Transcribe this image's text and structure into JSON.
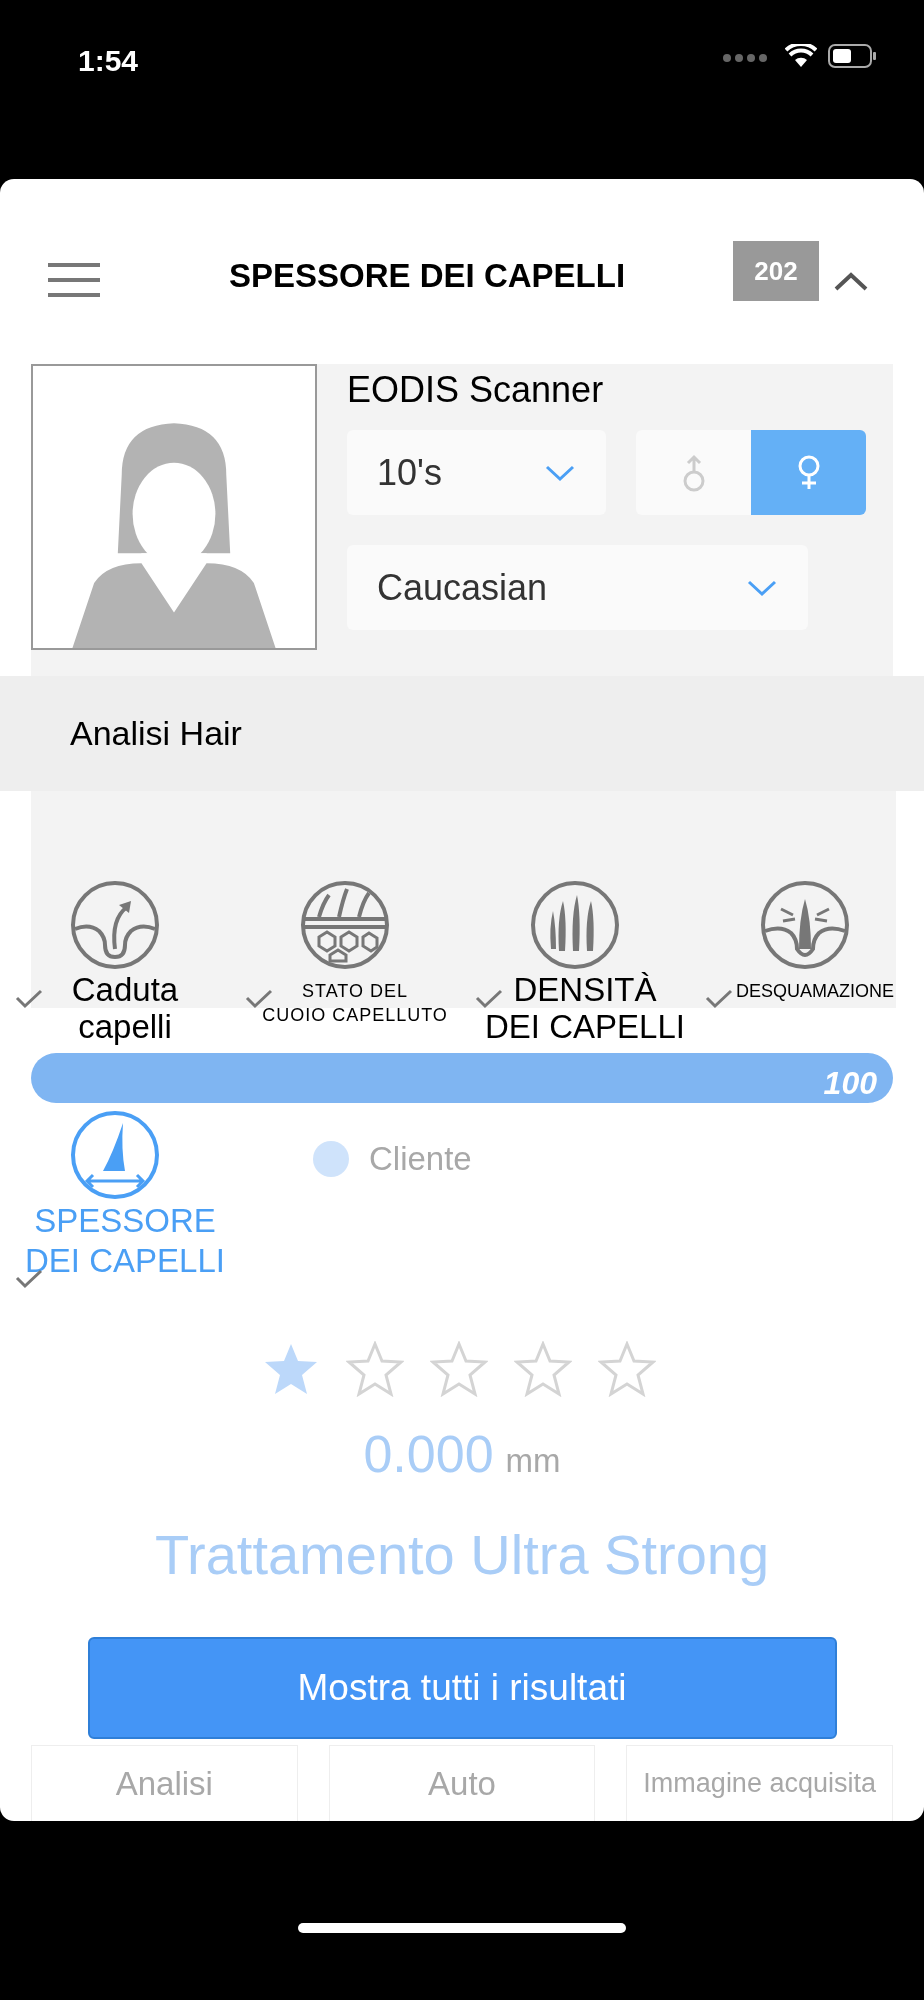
{
  "status_bar": {
    "time": "1:54"
  },
  "header": {
    "title": "SPESSORE DEI CAPELLI",
    "badge": "202"
  },
  "profile": {
    "device_name": "EODIS Scanner",
    "age": "10's",
    "gender": [
      {
        "kind": "male",
        "selected": false
      },
      {
        "kind": "female",
        "selected": true
      }
    ],
    "ethnicity": "Caucasian"
  },
  "section_title": "Analisi Hair",
  "categories": [
    {
      "kind": "hair-loss",
      "label": "Caduta\ncapelli",
      "checked": true,
      "selected": false
    },
    {
      "kind": "scalp",
      "label": "STATO DEL\nCUOIO CAPELLUTO",
      "checked": true,
      "selected": false
    },
    {
      "kind": "density",
      "label": "DENSITÀ\nDEI CAPELLI",
      "checked": true,
      "selected": false
    },
    {
      "kind": "dandruff",
      "label": "DESQUAMAZIONE",
      "checked": true,
      "selected": false
    },
    {
      "kind": "thickness",
      "label": "SPESSORE\nDEI CAPELLI",
      "checked": true,
      "selected": true
    }
  ],
  "progress": {
    "reading": "100"
  },
  "legend": {
    "label": "Cliente"
  },
  "rating": {
    "stars": 1
  },
  "measurement": {
    "value": "0.000",
    "unit": "mm"
  },
  "treatment": "Trattamento Ultra Strong",
  "button": "Mostra tutti i risultati",
  "bottom_tabs": [
    {
      "label": "Analisi",
      "selected": false
    },
    {
      "label": "Auto",
      "selected": false
    },
    {
      "label": "Immagine acquisita",
      "selected": false
    }
  ]
}
